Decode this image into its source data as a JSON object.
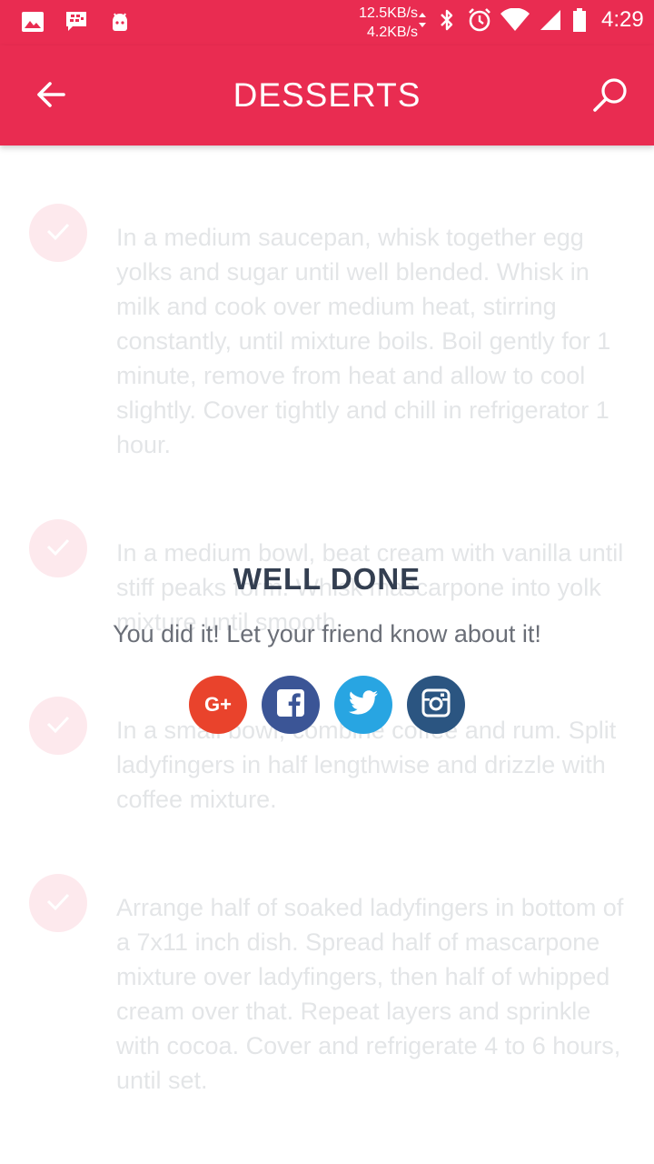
{
  "status_bar": {
    "net_up": "12.5KB/s",
    "net_down": "4.2KB/s",
    "time": "4:29",
    "icons": [
      "gallery-icon",
      "bbm-icon",
      "android-icon",
      "bluetooth-icon",
      "alarm-icon",
      "wifi-icon",
      "signal-icon",
      "battery-icon"
    ]
  },
  "app_bar": {
    "title": "DESSERTS",
    "background": "#e92c51",
    "icons": [
      "arrow-left-icon",
      "search-icon"
    ]
  },
  "steps": [
    {
      "text": "In a medium saucepan, whisk together egg yolks and sugar until well blended. Whisk in milk and cook over medium heat, stirring constantly, until mixture boils. Boil gently for 1 minute, remove from heat and allow to cool slightly. Cover tightly and chill in refrigerator 1 hour."
    },
    {
      "text": "In a medium bowl, beat cream with vanilla until stiff peaks form. Whisk mascarpone into yolk mixture until smooth."
    },
    {
      "text": "In a small bowl, combine coffee and rum. Split ladyfingers in half lengthwise and drizzle with coffee mixture."
    },
    {
      "text": "Arrange half of soaked ladyfingers in bottom of a 7x11 inch dish. Spread half of mascarpone mixture over ladyfingers, then half of whipped cream over that. Repeat layers and sprinkle with cocoa. Cover and refrigerate 4 to 6 hours, until set."
    }
  ],
  "dialog": {
    "title": "WELL DONE",
    "message": "You did it! Let your friend know about it!",
    "share": [
      {
        "name": "google-plus",
        "icon": "google-plus-icon",
        "glyph": "G+",
        "color": "#e9432c"
      },
      {
        "name": "facebook",
        "icon": "facebook-icon",
        "color": "#3b5596"
      },
      {
        "name": "twitter",
        "icon": "twitter-icon",
        "color": "#28a5e2"
      },
      {
        "name": "instagram",
        "icon": "instagram-icon",
        "color": "#2b5581"
      }
    ]
  }
}
